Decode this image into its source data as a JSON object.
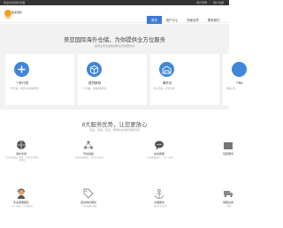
{
  "topbar": {
    "welcome": "欢迎访问海外仓储",
    "links": [
      "用户登录",
      "用户注册"
    ]
  },
  "header": {
    "logo_text": "美亚国际",
    "nav": [
      "首页",
      "用户中心",
      "商家合作",
      "联系我们"
    ]
  },
  "hero": {
    "title": "美亚国际海外仓储，为你提供全方位服务",
    "subtitle": "提供全球仓储物流解决方案服务商",
    "cards": [
      {
        "title": "一件代发",
        "desc": "一件代发，降低库存成本风险"
      },
      {
        "title": "退货换标",
        "desc": "一个包裹，快速退货换标"
      },
      {
        "title": "海外仓",
        "desc": "私人仓库，安全高效"
      },
      {
        "title": "FBA",
        "desc": "快速入仓"
      }
    ]
  },
  "features_section": {
    "title": "8大服务优势，让您更放心",
    "subtitle": "专业，高效，安全，帮助您在海外轻松开店",
    "items": [
      {
        "icon": "globe-icon",
        "title": "海外仓库",
        "desc": "位于美国核心地段，让你的货物更快到达"
      },
      {
        "icon": "network-icon",
        "title": "专线运输",
        "desc": "多条运输路线，为您节约成本"
      },
      {
        "icon": "chat-icon",
        "title": "在线客服",
        "desc": "专业客服团队，一对一服务"
      },
      {
        "icon": "package-icon",
        "title": "包装服务",
        "desc": ""
      },
      {
        "icon": "support-icon",
        "title": "专业客服团队",
        "desc": "一对一服务，让你更放心"
      },
      {
        "icon": "tag-icon",
        "title": "退货换标服务",
        "desc": "专业退换标团队"
      },
      {
        "icon": "anchor-icon",
        "title": "头程服务",
        "desc": "海运空运头程"
      },
      {
        "icon": "truck-icon",
        "title": "尾程派送",
        "desc": "准时"
      }
    ]
  },
  "colors": {
    "accent": "#3a7bd5",
    "icon": "#3f87d8",
    "topbar": "#333333"
  }
}
